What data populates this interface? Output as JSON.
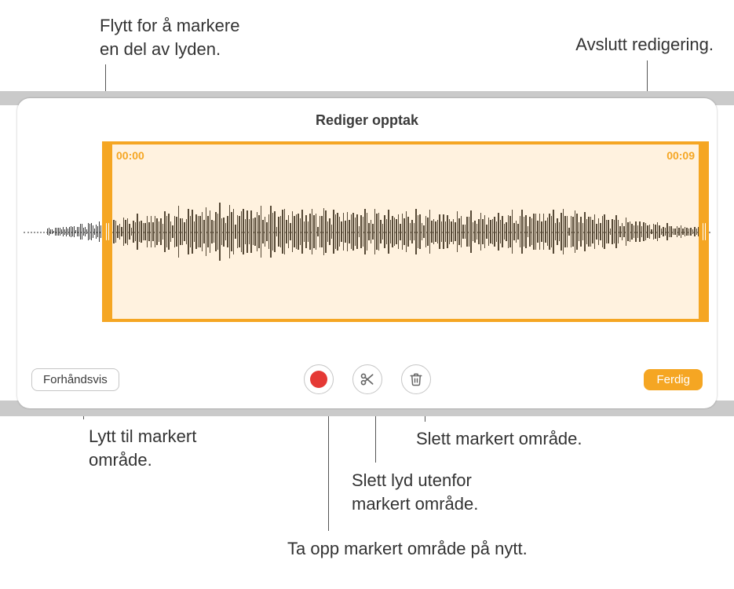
{
  "callouts": {
    "drag_handle": "Flytt for å markere\nen del av lyden.",
    "finish_editing": "Avslutt redigering.",
    "preview": "Lytt til markert\nområde.",
    "record": "Ta opp markert område på nytt.",
    "trim": "Slett lyd utenfor\nmarkert område.",
    "delete": "Slett markert område."
  },
  "panel": {
    "title": "Rediger opptak",
    "selection_start": "00:00",
    "selection_end": "00:09",
    "preview_label": "Forhåndsvis",
    "done_label": "Ferdig"
  },
  "icons": {
    "record": "record-icon",
    "trim": "scissors-icon",
    "delete": "trash-icon"
  }
}
